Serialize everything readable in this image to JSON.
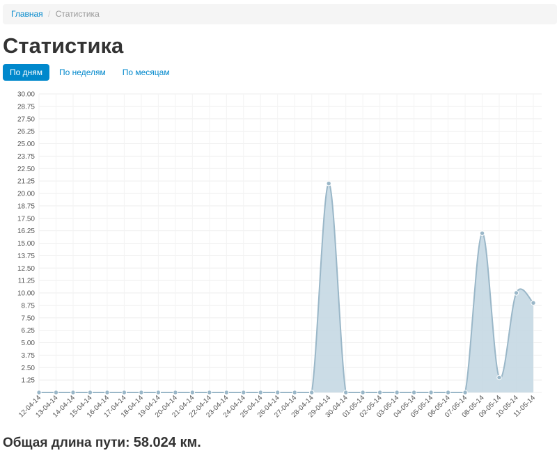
{
  "breadcrumb": {
    "home_label": "Главная",
    "separator": "/",
    "current_label": "Статистика"
  },
  "page": {
    "title": "Статистика"
  },
  "tabs": [
    {
      "label": "По дням",
      "active": true
    },
    {
      "label": "По неделям",
      "active": false
    },
    {
      "label": "По месяцам",
      "active": false
    }
  ],
  "colors": {
    "accent": "#0088cc",
    "series_line": "#9ab7c8",
    "series_fill": "#c5d8e3",
    "grid": "#eeeeee"
  },
  "chart_data": {
    "type": "area",
    "title": "",
    "xlabel": "",
    "ylabel": "",
    "ylim": [
      0,
      30
    ],
    "y_ticks": [
      "1.25",
      "2.50",
      "3.75",
      "5.00",
      "6.25",
      "7.50",
      "8.75",
      "10.00",
      "11.25",
      "12.50",
      "13.75",
      "15.00",
      "16.25",
      "17.50",
      "18.75",
      "20.00",
      "21.25",
      "22.50",
      "23.75",
      "25.00",
      "26.25",
      "27.50",
      "28.75",
      "30.00"
    ],
    "grid": true,
    "categories": [
      "12-04-14",
      "13-04-14",
      "14-04-14",
      "15-04-14",
      "16-04-14",
      "17-04-14",
      "18-04-14",
      "19-04-14",
      "20-04-14",
      "21-04-14",
      "22-04-14",
      "23-04-14",
      "24-04-14",
      "25-04-14",
      "26-04-14",
      "27-04-14",
      "28-04-14",
      "29-04-14",
      "30-04-14",
      "01-05-14",
      "02-05-14",
      "03-05-14",
      "04-05-14",
      "05-05-14",
      "06-05-14",
      "07-05-14",
      "08-05-14",
      "09-05-14",
      "10-05-14",
      "11-05-14"
    ],
    "series": [
      {
        "values": [
          0,
          0,
          0,
          0,
          0,
          0,
          0,
          0,
          0,
          0,
          0,
          0,
          0,
          0,
          0,
          0,
          0,
          21.0,
          0,
          0,
          0,
          0,
          0,
          0,
          0,
          0,
          16.0,
          1.5,
          10.0,
          9.0
        ]
      }
    ]
  },
  "footer": {
    "total_label": "Общая длина пути:",
    "total_value": "58.024 км."
  }
}
